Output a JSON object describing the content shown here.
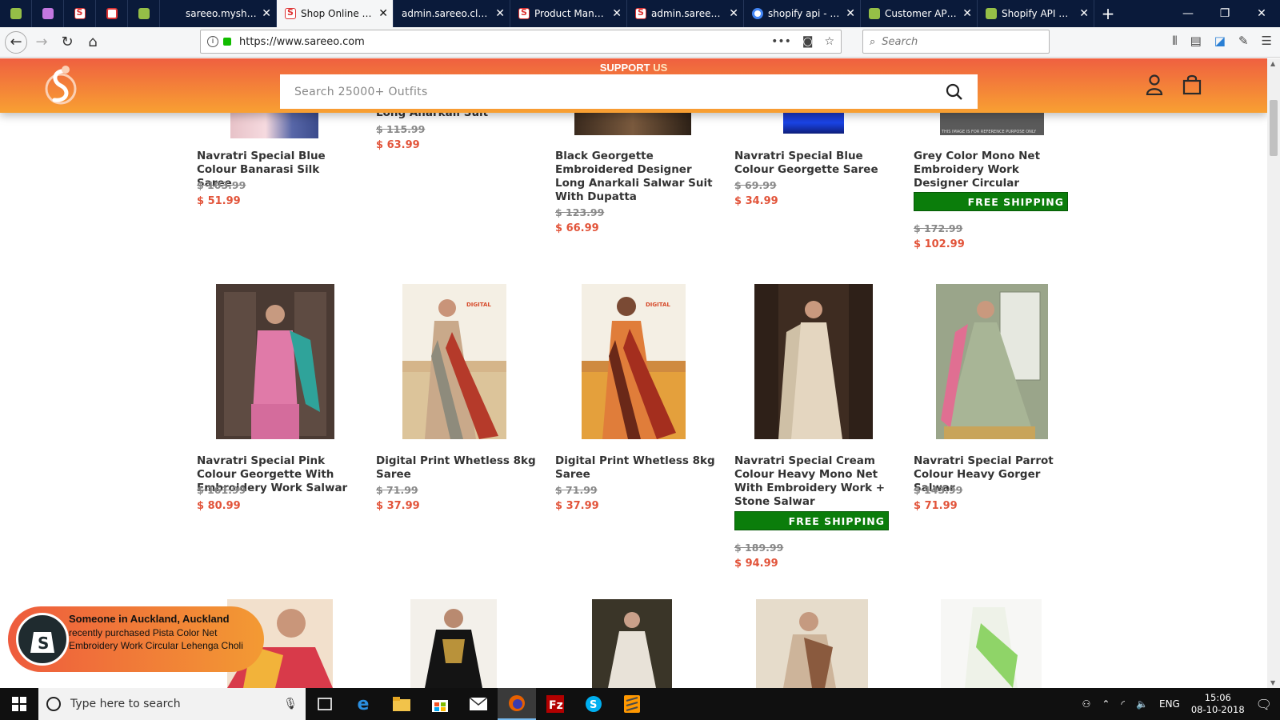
{
  "browser": {
    "tabs": [
      {
        "title": "sareeo.myshopify",
        "icon": "shopify"
      },
      {
        "title": "Shop Online Saree",
        "icon": "sareeo",
        "active": true
      },
      {
        "title": "admin.sareeo.clothing",
        "icon": "none"
      },
      {
        "title": "Product Manage",
        "icon": "sareeo"
      },
      {
        "title": "admin.sareeo.clo",
        "icon": "sareeo"
      },
      {
        "title": "shopify api - Goo",
        "icon": "google"
      },
      {
        "title": "Customer APIs ·",
        "icon": "shopify"
      },
      {
        "title": "Shopify API — Yo",
        "icon": "shopify"
      }
    ],
    "url": "https://www.sareeo.com",
    "search_placeholder": "Search"
  },
  "site": {
    "support_text": "SUPPORT",
    "support_us": " US",
    "search_placeholder": "Search 25000+ Outfits",
    "colors": {
      "header_top": "#ef6040",
      "header_bottom": "#f8a032",
      "price": "#e2543a",
      "free_shipping": "#0b7d0b"
    }
  },
  "products": {
    "row1": [
      {
        "name": "Navratri Special Blue Colour Banarasi Silk Saree",
        "old": "$ 103.99",
        "new": "$ 51.99"
      },
      {
        "name": "Long Anarkali Suit",
        "old": "$ 115.99",
        "new": "$ 63.99"
      },
      {
        "name": "Black Georgette Embroidered Designer Long Anarkali Salwar Suit With Dupatta",
        "old": "$ 123.99",
        "new": "$ 66.99"
      },
      {
        "name": "Navratri Special Blue Colour Georgette Saree",
        "old": "$ 69.99",
        "new": "$ 34.99"
      },
      {
        "name": "Grey Color Mono Net Embroidery Work Designer Circular Lehenga Choli",
        "badge": "FREE SHIPPING",
        "old": "$ 172.99",
        "new": "$ 102.99"
      }
    ],
    "row2": [
      {
        "name": "Navratri Special Pink Colour Georgette With Embroidery Work Salwar",
        "old": "$ 161.99",
        "new": "$ 80.99"
      },
      {
        "name": "Digital Print Whetless 8kg Saree",
        "old": "$ 71.99",
        "new": "$ 37.99",
        "tag": "DIGITAL"
      },
      {
        "name": "Digital Print Whetless 8kg Saree",
        "old": "$ 71.99",
        "new": "$ 37.99",
        "tag": "DIGITAL"
      },
      {
        "name": "Navratri Special Cream Colour Heavy Mono Net With Embroidery Work + Stone Salwar",
        "badge": "FREE SHIPPING",
        "old": "$ 189.99",
        "new": "$ 94.99"
      },
      {
        "name": "Navratri Special Parrot Colour Heavy Gorger Salwar",
        "old": "$ 143.99",
        "new": "$ 71.99"
      }
    ],
    "image_note_row1_last": "THIS IMAGE IS FOR REFERENCE PURPOSE ONLY"
  },
  "popup": {
    "line1": "Someone in Auckland, Auckland",
    "line2": "recently purchased Pista Color Net Embroidery Work Circular Lehenga Choli"
  },
  "taskbar": {
    "search_placeholder": "Type here to search",
    "language": "ENG",
    "time": "15:06",
    "date": "08-10-2018"
  }
}
